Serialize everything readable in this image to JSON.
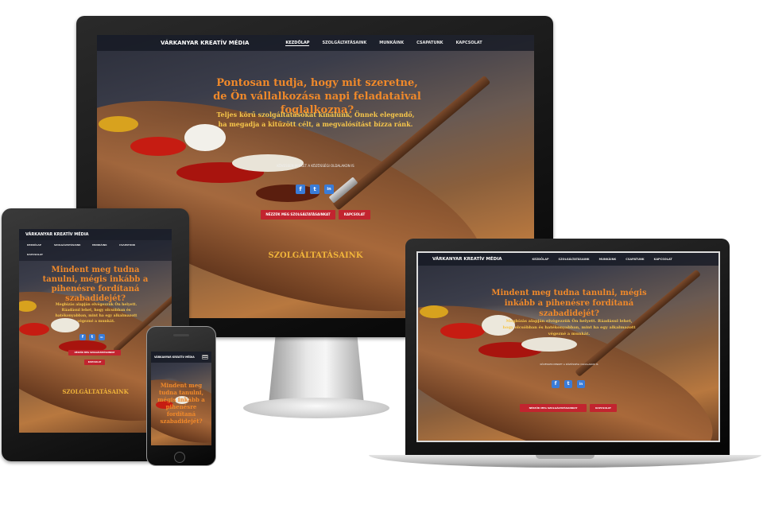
{
  "site": {
    "brand": "VÁRKANYAR KREATÍV MÉDIA",
    "nav": [
      "KEZDŐLAP",
      "SZOLGÁLTATÁSAINK",
      "MUNKÁINK",
      "CSAPATUNK",
      "KAPCSOLAT"
    ],
    "social": [
      "f",
      "t",
      "in"
    ],
    "buttons": {
      "services": "NÉZZÜK MEG SZOLGÁLTATÁSAINKAT",
      "contact": "KAPCSOLAT"
    },
    "section_title": "SZOLGÁLTATÁSAINK",
    "small_caption": "KÖVESSEN MINKET A KÖZÖSSÉGI OLDALAKON IS"
  },
  "desktop": {
    "headline": "Pontosan tudja, hogy mit szeretne, de Ön vállalkozása napi feladataival foglalkozna?",
    "subtext": "Teljes körű szolgáltatásokat kínálunk, Önnek elegendő, ha megadja a kitűzött célt, a megvalósítást bízza ránk."
  },
  "laptop": {
    "headline": "Mindent meg tudna tanulni, mégis inkább a pihenésre fordítaná szabadidejét?",
    "subtext": "Megbízás alapján elvégezzük Ön helyett. Ráadásul lehet, hogy olcsóbban és hatékonyabban, mint ha egy alkalmazott végezné a munkát."
  },
  "tablet": {
    "headline": "Mindent meg tudna tanulni, mégis inkább a pihenésre fordítaná szabadidejét?",
    "subtext": "Megbízás alapján elvégezzük Ön helyett. Ráadásul lehet, hogy olcsóbban és hatékonyabban, mint ha egy alkalmazott végezné a munkát."
  },
  "phone": {
    "headline": "Mindent meg tudna tanulni, mégis inkább a pihenésre fordítaná szabadidejét?"
  },
  "colors": {
    "accent_orange": "#f0892a",
    "accent_yellow": "#f7c64a",
    "button_red": "#c2242f",
    "social_blue": "#3a7cd8"
  }
}
